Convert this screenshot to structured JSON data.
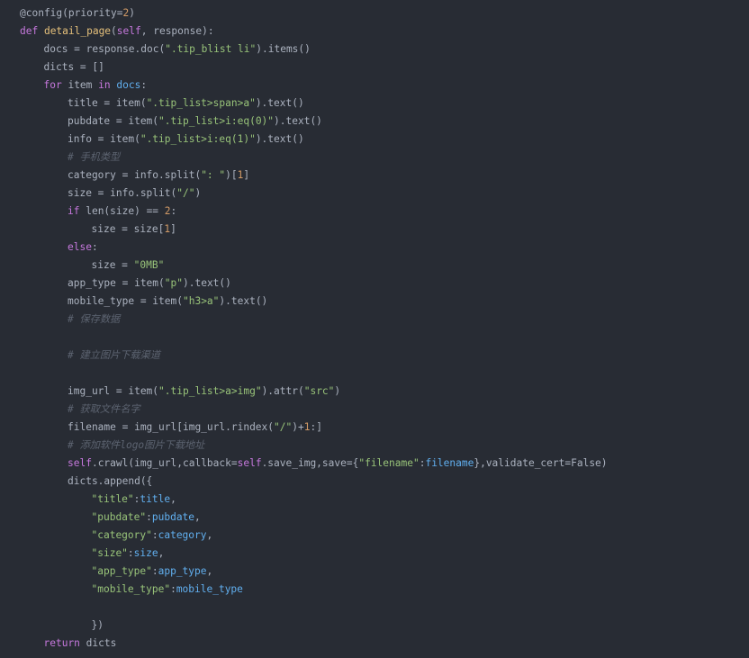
{
  "theme": {
    "background": "#282c34",
    "default": "#abb2bf",
    "keyword": "#c678dd",
    "function": "#e5c07b",
    "string": "#98c379",
    "number": "#d19a66",
    "comment": "#5c6370",
    "variable": "#61afef"
  },
  "lines": [
    {
      "indent": 0,
      "tokens": [
        [
          "dec",
          "@config(priority="
        ],
        [
          "num",
          "2"
        ],
        [
          "pl",
          ")"
        ]
      ]
    },
    {
      "indent": 0,
      "tokens": [
        [
          "kw",
          "def "
        ],
        [
          "fn",
          "detail_page"
        ],
        [
          "pl",
          "("
        ],
        [
          "self",
          "self"
        ],
        [
          "pl",
          ", response):"
        ]
      ]
    },
    {
      "indent": 1,
      "tokens": [
        [
          "pl",
          "docs = response.doc("
        ],
        [
          "str",
          "\".tip_blist li\""
        ],
        [
          "pl",
          ").items()"
        ]
      ]
    },
    {
      "indent": 1,
      "tokens": [
        [
          "pl",
          "dicts = []"
        ]
      ]
    },
    {
      "indent": 1,
      "tokens": [
        [
          "kw",
          "for "
        ],
        [
          "pl",
          "item "
        ],
        [
          "kw",
          "in "
        ],
        [
          "var",
          "docs"
        ],
        [
          "pl",
          ":"
        ]
      ]
    },
    {
      "indent": 2,
      "tokens": [
        [
          "pl",
          "title = item("
        ],
        [
          "str",
          "\".tip_list>span>a\""
        ],
        [
          "pl",
          ").text()"
        ]
      ]
    },
    {
      "indent": 2,
      "tokens": [
        [
          "pl",
          "pubdate = item("
        ],
        [
          "str",
          "\".tip_list>i:eq(0)\""
        ],
        [
          "pl",
          ").text()"
        ]
      ]
    },
    {
      "indent": 2,
      "tokens": [
        [
          "pl",
          "info = item("
        ],
        [
          "str",
          "\".tip_list>i:eq(1)\""
        ],
        [
          "pl",
          ").text()"
        ]
      ]
    },
    {
      "indent": 2,
      "tokens": [
        [
          "cm",
          "# 手机类型"
        ]
      ]
    },
    {
      "indent": 2,
      "tokens": [
        [
          "pl",
          "category = info.split("
        ],
        [
          "str",
          "\": \""
        ],
        [
          "pl",
          ")["
        ],
        [
          "num",
          "1"
        ],
        [
          "pl",
          "]"
        ]
      ]
    },
    {
      "indent": 2,
      "tokens": [
        [
          "pl",
          "size = info.split("
        ],
        [
          "str",
          "\"/\""
        ],
        [
          "pl",
          ")"
        ]
      ]
    },
    {
      "indent": 2,
      "tokens": [
        [
          "kw",
          "if "
        ],
        [
          "pl",
          "len(size) == "
        ],
        [
          "num",
          "2"
        ],
        [
          "pl",
          ":"
        ]
      ]
    },
    {
      "indent": 3,
      "tokens": [
        [
          "pl",
          "size = size["
        ],
        [
          "num",
          "1"
        ],
        [
          "pl",
          "]"
        ]
      ]
    },
    {
      "indent": 2,
      "tokens": [
        [
          "kw",
          "else"
        ],
        [
          "pl",
          ":"
        ]
      ]
    },
    {
      "indent": 3,
      "tokens": [
        [
          "pl",
          "size = "
        ],
        [
          "str",
          "\"0MB\""
        ]
      ]
    },
    {
      "indent": 2,
      "tokens": [
        [
          "pl",
          "app_type = item("
        ],
        [
          "str",
          "\"p\""
        ],
        [
          "pl",
          ").text()"
        ]
      ]
    },
    {
      "indent": 2,
      "tokens": [
        [
          "pl",
          "mobile_type = item("
        ],
        [
          "str",
          "\"h3>a\""
        ],
        [
          "pl",
          ").text()"
        ]
      ]
    },
    {
      "indent": 2,
      "tokens": [
        [
          "cm",
          "# 保存数据"
        ]
      ]
    },
    {
      "indent": 0,
      "tokens": []
    },
    {
      "indent": 2,
      "tokens": [
        [
          "cm",
          "# 建立图片下载渠道"
        ]
      ]
    },
    {
      "indent": 0,
      "tokens": []
    },
    {
      "indent": 2,
      "tokens": [
        [
          "pl",
          "img_url = item("
        ],
        [
          "str",
          "\".tip_list>a>img\""
        ],
        [
          "pl",
          ").attr("
        ],
        [
          "str",
          "\"src\""
        ],
        [
          "pl",
          ")"
        ]
      ]
    },
    {
      "indent": 2,
      "tokens": [
        [
          "cm",
          "# 获取文件名字"
        ]
      ]
    },
    {
      "indent": 2,
      "tokens": [
        [
          "pl",
          "filename = img_url[img_url.rindex("
        ],
        [
          "str",
          "\"/\""
        ],
        [
          "pl",
          ")+"
        ],
        [
          "num",
          "1"
        ],
        [
          "pl",
          ":]"
        ]
      ]
    },
    {
      "indent": 2,
      "tokens": [
        [
          "cm",
          "# 添加软件logo图片下载地址"
        ]
      ]
    },
    {
      "indent": 2,
      "tokens": [
        [
          "self",
          "self"
        ],
        [
          "pl",
          ".crawl(img_url,callback="
        ],
        [
          "self",
          "self"
        ],
        [
          "pl",
          ".save_img,save={"
        ],
        [
          "str",
          "\"filename\""
        ],
        [
          "pl",
          ":"
        ],
        [
          "var",
          "filename"
        ],
        [
          "pl",
          "},validate_cert=False)"
        ]
      ]
    },
    {
      "indent": 2,
      "tokens": [
        [
          "pl",
          "dicts.append({"
        ]
      ]
    },
    {
      "indent": 3,
      "tokens": [
        [
          "str",
          "\"title\""
        ],
        [
          "pl",
          ":"
        ],
        [
          "var",
          "title"
        ],
        [
          "pl",
          ","
        ]
      ]
    },
    {
      "indent": 3,
      "tokens": [
        [
          "str",
          "\"pubdate\""
        ],
        [
          "pl",
          ":"
        ],
        [
          "var",
          "pubdate"
        ],
        [
          "pl",
          ","
        ]
      ]
    },
    {
      "indent": 3,
      "tokens": [
        [
          "str",
          "\"category\""
        ],
        [
          "pl",
          ":"
        ],
        [
          "var",
          "category"
        ],
        [
          "pl",
          ","
        ]
      ]
    },
    {
      "indent": 3,
      "tokens": [
        [
          "str",
          "\"size\""
        ],
        [
          "pl",
          ":"
        ],
        [
          "var",
          "size"
        ],
        [
          "pl",
          ","
        ]
      ]
    },
    {
      "indent": 3,
      "tokens": [
        [
          "str",
          "\"app_type\""
        ],
        [
          "pl",
          ":"
        ],
        [
          "var",
          "app_type"
        ],
        [
          "pl",
          ","
        ]
      ]
    },
    {
      "indent": 3,
      "tokens": [
        [
          "str",
          "\"mobile_type\""
        ],
        [
          "pl",
          ":"
        ],
        [
          "var",
          "mobile_type"
        ]
      ]
    },
    {
      "indent": 0,
      "tokens": []
    },
    {
      "indent": 3,
      "tokens": [
        [
          "pl",
          "})"
        ]
      ]
    },
    {
      "indent": 1,
      "tokens": [
        [
          "kw",
          "return "
        ],
        [
          "pl",
          "dicts"
        ]
      ]
    }
  ]
}
